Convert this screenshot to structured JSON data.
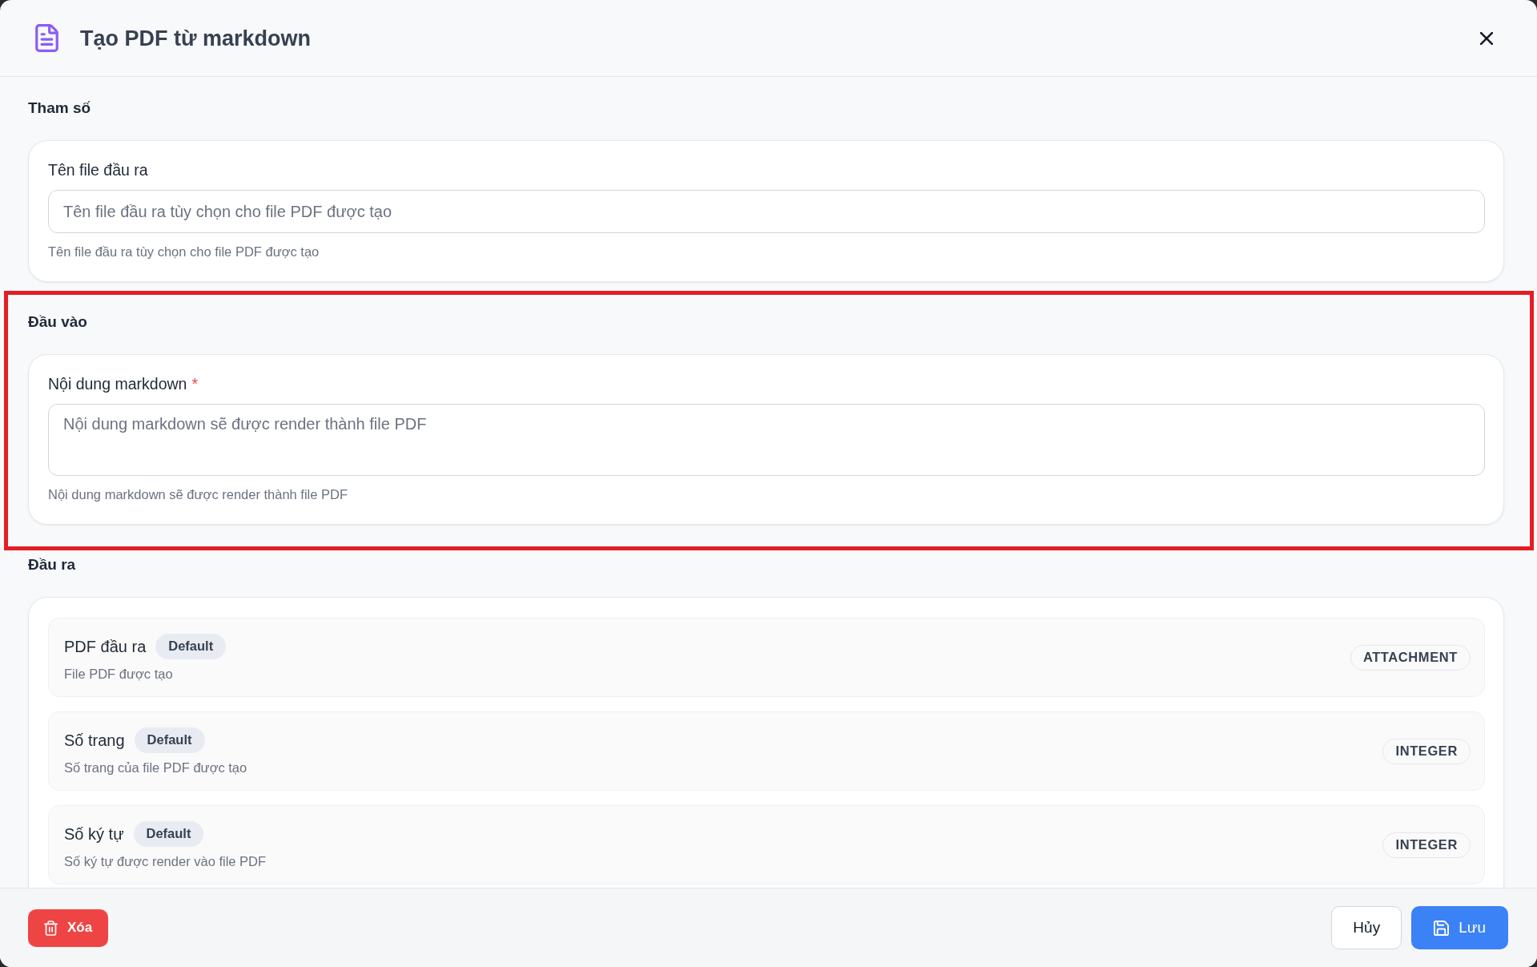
{
  "dialog": {
    "title": "Tạo PDF từ markdown"
  },
  "sections": [
    {
      "title": "Tham số",
      "kind": "fields",
      "highlighted": false,
      "fields": [
        {
          "kind": "text",
          "label": "Tên file đầu ra",
          "placeholder": "Tên file đầu ra tùy chọn cho file PDF được tạo",
          "help": "Tên file đầu ra tùy chọn cho file PDF được tạo"
        }
      ]
    },
    {
      "title": "Đầu vào",
      "kind": "fields",
      "highlighted": true,
      "fields": [
        {
          "kind": "textarea",
          "label": "Nội dung markdown",
          "required_mark": "*",
          "placeholder": "Nội dung markdown sẽ được render thành file PDF",
          "help": "Nội dung markdown sẽ được render thành file PDF"
        }
      ]
    },
    {
      "title": "Đầu ra",
      "kind": "outputs",
      "highlighted": false,
      "outputs": [
        {
          "name": "PDF đầu ra",
          "badge": "Default",
          "description": "File PDF được tạo",
          "type": "ATTACHMENT"
        },
        {
          "name": "Số trang",
          "badge": "Default",
          "description": "Số trang của file PDF được tạo",
          "type": "INTEGER"
        },
        {
          "name": "Số ký tự",
          "badge": "Default",
          "description": "Số ký tự được render vào file PDF",
          "type": "INTEGER"
        }
      ]
    }
  ],
  "footer": {
    "buttons": [
      {
        "kind": "delete",
        "label": "Xóa"
      },
      {
        "kind": "cancel",
        "label": "Hủy"
      },
      {
        "kind": "save",
        "label": "Lưu"
      }
    ]
  }
}
